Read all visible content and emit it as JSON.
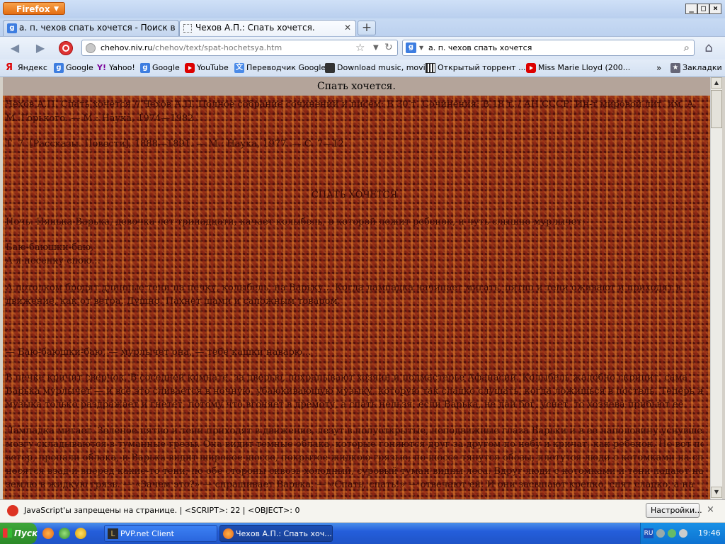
{
  "window": {
    "app_button": "Firefox",
    "controls": [
      "_",
      "□",
      "×"
    ]
  },
  "tabs": [
    {
      "title": "а. п. чехов спать хочется - Поиск в Go...",
      "icon": "google-icon",
      "active": false
    },
    {
      "title": "Чехов А.П.: Спать хочется.",
      "icon": "page-icon",
      "active": true
    }
  ],
  "newtab_label": "+",
  "nav": {
    "url_host": "chehov.niv.ru",
    "url_path": "/chehov/text/spat-hochetsya.htm",
    "url_prefix": "",
    "search_value": "а. п. чехов спать хочется",
    "search_icon": "magnifier-icon",
    "home_icon": "home-icon"
  },
  "bookmarks": [
    {
      "label": "Яндекс",
      "icon": "yandex-icon"
    },
    {
      "label": "Google",
      "icon": "google-icon"
    },
    {
      "label": "Yahoo!",
      "icon": "yahoo-icon"
    },
    {
      "label": "Google",
      "icon": "google-icon"
    },
    {
      "label": "YouTube",
      "icon": "youtube-icon"
    },
    {
      "label": "Переводчик Google",
      "icon": "translate-icon"
    },
    {
      "label": "Download music, movi...",
      "icon": "download-icon"
    },
    {
      "label": "Открытый торрент ...",
      "icon": "torrent-icon"
    },
    {
      "label": "Miss Marie Lloyd (200...",
      "icon": "youtube-icon"
    }
  ],
  "bookmarks_more": "»",
  "bookmarks_menu": "Закладки",
  "content": {
    "header": "Спать хочется.",
    "lines": [
      "Чехов А.П. Спать хочется // Чехов А.П. Полное собрание сочинений и писем: В 30 т. Сочинения: В 18 т. / АН СССР. Ин-т мировой лит. им. А.",
      "М. Горького. — М.: Наука, 1974—1982.",
      "Т. 7. [Рассказы. Повести], 1888—1891. — М.: Наука, 1977. — С. 7—12.",
      "СПАТЬ ХОЧЕТСЯ",
      "Ночь. Нянька Варька, девочка лет тринадцати, качает колыбель, в которой лежит ребенок, и чуть слышно мурлычет:",
      "Баю-баюшки-баю,",
      "А я песенку спою...",
      "А потолком бродят длинные тени на печку, колыбель, на Варьку... Когда лампадка начинает мигать, пятно и тени оживают и приходят в",
      "движение, как от ветра. Душно. Пахнет щами и сапожным товаром.",
      "...",
      "— Баю-баюшки-баю, — мурлычет она, — тебе кашки наварю...",
      "В печке кричит сверчок. В соседней комнате, за дверью, похрапывают хозяин и подмастерье Афанасий. Колыбель жалобно скрипит, сама",
      "Варька мурлычет — и всё это сливается в ночную, убаюкивающую музыку, которую так сладко слушать, когда ложишься в постель. Теперь же эта",
      "музыка только раздражает и гнетет, потому что вгоняет в дремоту, а спать нельзя; если Варька, не дай бог, уснет, то хозяева прибьют ее.",
      "Лампадка мигает. Зеленое пятно и тени приходят в движение, лезут в полуоткрытые, неподвижные глаза Варьки и в ее наполовину уснувшем",
      "мозгу складываются в туманные грезы. Она видит темные облака, которые гоняются друг за другом по небу и кричат, как ребенок. Но вот подул",
      "ветер, пропали облака, и Варька видит широкое шоссе, покрытое жидкою грязью; по шоссе тянутся обозы, плетутся люди с котомками на спинах,",
      "носятся взад и вперед какие-то тени; по обе стороны сквозь холодный, суровый туман видны леса. Вдруг люди с котомками и тени падают на",
      "землю в жидкую грязь. — «Зачем это?» — спрашивает Варька. — «Спать, спать!» — отвечают ей. И они засыпают крепко, спят сладко, а на"
    ]
  },
  "noscript": {
    "message": "JavaScript'ы запрещены на странице. | <SCRIPT>: 22 | <OBJECT>: 0",
    "settings_button": "Настройки...",
    "close": "×"
  },
  "taskbar": {
    "start_label": "Пуск",
    "tasks": [
      {
        "label": "PVP.net Client",
        "icon": "pvp-icon",
        "active": false
      },
      {
        "label": "Чехов А.П.: Спать хоч...",
        "icon": "firefox-icon",
        "active": true
      }
    ],
    "lang": "RU",
    "clock": "19:46"
  },
  "colors": {
    "title_bar": "#c3d7f2",
    "content_bg": "#6b1a12",
    "content_header_bg": "#b4a49a",
    "taskbar": "#245edb",
    "start_button": "#3a9a35"
  }
}
